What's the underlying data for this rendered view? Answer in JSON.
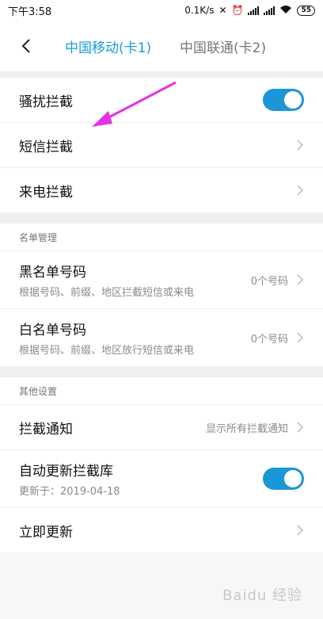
{
  "status": {
    "time": "下午3:58",
    "speed": "0.1K/s",
    "battery": "55"
  },
  "header": {
    "tab_active": "中国移动(卡1)",
    "tab_inactive": "中国联通(卡2)"
  },
  "section1": {
    "harassment": "骚扰拦截",
    "sms": "短信拦截",
    "call": "来电拦截"
  },
  "lists": {
    "group_label": "名单管理",
    "blacklist_title": "黑名单号码",
    "blacklist_sub": "根据号码、前缀、地区拦截短信或来电",
    "blacklist_value": "0个号码",
    "whitelist_title": "白名单号码",
    "whitelist_sub": "根据号码、前缀、地区放行短信或来电",
    "whitelist_value": "0个号码"
  },
  "other": {
    "group_label": "其他设置",
    "notify_title": "拦截通知",
    "notify_value": "显示所有拦截通知",
    "autoupdate_title": "自动更新拦截库",
    "autoupdate_sub": "更新于：2019-04-18",
    "update_now": "立即更新"
  },
  "watermark": "Baidu 经验",
  "colors": {
    "accent": "#1b9bd8",
    "annotation": "#e433e6"
  }
}
